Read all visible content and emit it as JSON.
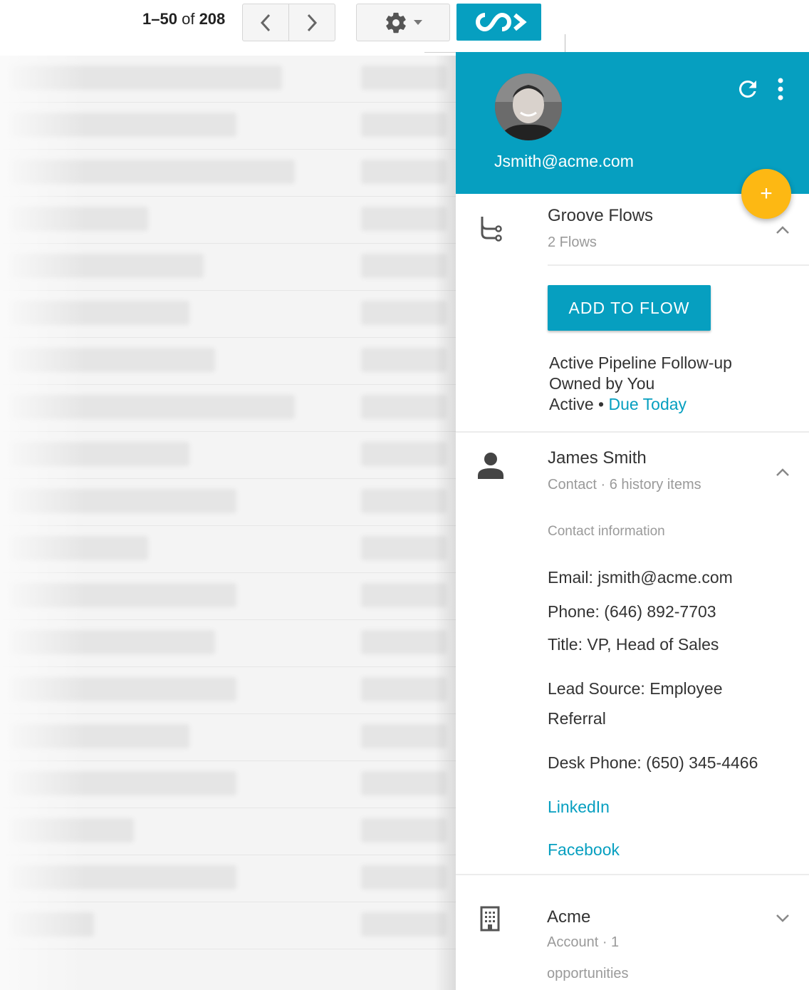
{
  "toolbar": {
    "pager_range": "1–50",
    "pager_of": "of",
    "pager_total": "208",
    "prev_icon": "chevron-left-icon",
    "next_icon": "chevron-right-icon",
    "settings_icon": "gear-icon",
    "groove_icon": "groove-logo-icon"
  },
  "panel": {
    "header": {
      "email": "Jsmith@acme.com",
      "refresh_icon": "refresh-icon",
      "more_icon": "more-vert-icon",
      "fab_label": "+"
    },
    "flows": {
      "title": "Groove Flows",
      "subtitle": "2 Flows",
      "add_button": "ADD TO FLOW",
      "flow_name": "Active Pipeline Follow-up",
      "owner": "Owned by You",
      "status": "Active",
      "separator": " • ",
      "due": "Due Today"
    },
    "contact": {
      "name": "James Smith",
      "subtitle": "Contact · 6 history items",
      "info_label": "Contact information",
      "email": "Email: jsmith@acme.com",
      "phone": "Phone: (646) 892-7703",
      "title": "Title: VP, Head of Sales",
      "lead_source_1": "Lead Source: Employee",
      "lead_source_2": "Referral",
      "desk_phone": "Desk Phone: (650) 345-4466",
      "linkedin": "LinkedIn",
      "facebook": "Facebook"
    },
    "account": {
      "name": "Acme",
      "subtitle_1": "Account · 1",
      "subtitle_2": "opportunities"
    }
  },
  "colors": {
    "accent": "#069fc0",
    "fab": "#fdb813"
  }
}
